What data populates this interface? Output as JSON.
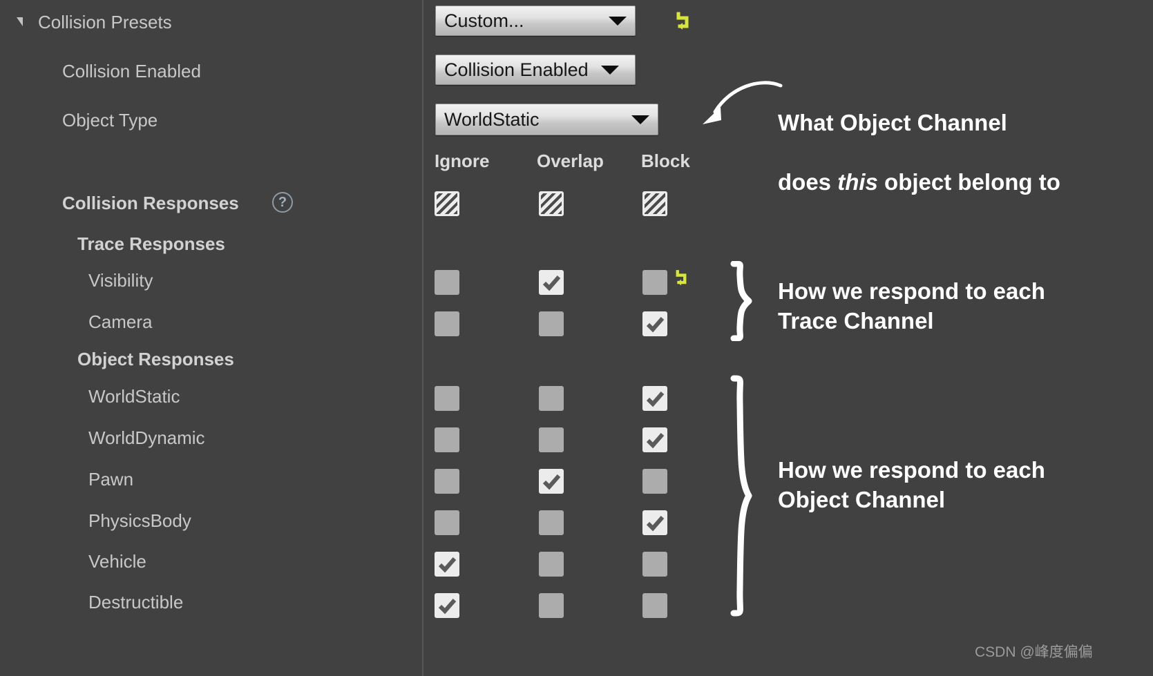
{
  "section": {
    "title": "Collision Presets",
    "expander_icon": "triangle-expanded-icon"
  },
  "properties": {
    "collision_enabled_label": "Collision Enabled",
    "object_type_label": "Object Type",
    "collision_responses_label": "Collision Responses",
    "trace_responses_label": "Trace Responses",
    "object_responses_label": "Object Responses",
    "help_icon": "?",
    "help_icon_name": "help-question-icon"
  },
  "combos": {
    "preset": {
      "value": "Custom...",
      "arrow_icon": "chevron-down-icon"
    },
    "collision_enabled": {
      "value": "Collision Enabled",
      "arrow_icon": "chevron-down-icon"
    },
    "object_type": {
      "value": "WorldStatic",
      "arrow_icon": "chevron-down-icon"
    }
  },
  "reset_icons": {
    "name": "reset-to-default-arrow-icon",
    "color": "#d8e63a"
  },
  "columns": {
    "ignore": "Ignore",
    "overlap": "Overlap",
    "block": "Block"
  },
  "rows": [
    {
      "key": "collision_responses",
      "label": "Collision Responses",
      "states": [
        "hatch",
        "hatch",
        "hatch"
      ]
    },
    {
      "key": "visibility",
      "label": "Visibility",
      "states": [
        "off",
        "on",
        "off"
      ]
    },
    {
      "key": "camera",
      "label": "Camera",
      "states": [
        "off",
        "off",
        "on"
      ]
    },
    {
      "key": "world_static",
      "label": "WorldStatic",
      "states": [
        "off",
        "off",
        "on"
      ]
    },
    {
      "key": "world_dynamic",
      "label": "WorldDynamic",
      "states": [
        "off",
        "off",
        "on"
      ]
    },
    {
      "key": "pawn",
      "label": "Pawn",
      "states": [
        "off",
        "on",
        "off"
      ]
    },
    {
      "key": "physics_body",
      "label": "PhysicsBody",
      "states": [
        "off",
        "off",
        "on"
      ]
    },
    {
      "key": "vehicle",
      "label": "Vehicle",
      "states": [
        "on",
        "off",
        "off"
      ]
    },
    {
      "key": "destructible",
      "label": "Destructible",
      "states": [
        "on",
        "off",
        "off"
      ]
    }
  ],
  "annotations": {
    "object_channel_line1": "What Object Channel",
    "object_channel_line2_a": "does ",
    "object_channel_line2_em": "this",
    "object_channel_line2_b": " object belong to",
    "trace": "How we respond to each\nTrace Channel",
    "object": "How we respond to each\nObject Channel"
  },
  "watermark": {
    "text": "CSDN @峰度偏偏"
  },
  "colors": {
    "background": "#414141",
    "label_text": "#c8c8c8",
    "annotation_text": "#ffffff",
    "reset_yellow": "#d8e63a",
    "checkbox_off": "#abacab",
    "checkbox_on": "#ececec",
    "splitter": "#565656"
  }
}
